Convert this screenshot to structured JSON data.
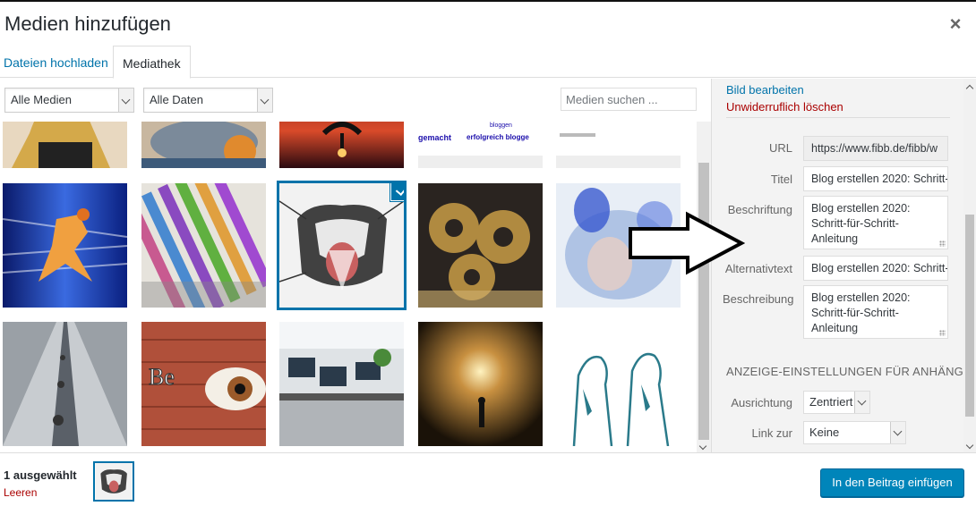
{
  "modal": {
    "title": "Medien hinzufügen",
    "close_icon": "×"
  },
  "tabs": [
    {
      "label": "Dateien hochladen",
      "active": false
    },
    {
      "label": "Mediathek",
      "active": true
    }
  ],
  "filters": {
    "media_type": "Alle Medien",
    "dates": "Alle Daten",
    "search_placeholder": "Medien suchen ..."
  },
  "thumbnails": {
    "partial_text": [
      "gemacht",
      "erfolgreich blogge",
      "bloggen"
    ],
    "selected_index": 2
  },
  "sidebar": {
    "edit_link": "Bild bearbeiten",
    "delete_link": "Unwiderruflich löschen",
    "fields": {
      "url_label": "URL",
      "url_value": "https://www.fibb.de/fibb/w",
      "title_label": "Titel",
      "title_value": "Blog erstellen 2020: Schritt-",
      "caption_label": "Beschriftung",
      "caption_value": "Blog erstellen 2020: Schritt-für-Schritt-Anleitung",
      "alt_label": "Alternativtext",
      "alt_value": "Blog erstellen 2020: Schritt-",
      "description_label": "Beschreibung",
      "description_value": "Blog erstellen 2020: Schritt-für-Schritt-Anleitung"
    },
    "display_heading": "ANZEIGE-EINSTELLUNGEN FÜR ANHÄNGE",
    "align_label": "Ausrichtung",
    "align_value": "Zentriert",
    "link_label": "Link zur",
    "link_value": "Keine"
  },
  "footer": {
    "selection_count": "1 ausgewählt",
    "clear_link": "Leeren",
    "insert_button": "In den Beitrag einfügen"
  },
  "colors": {
    "accent": "#0073aa",
    "button": "#0085ba",
    "danger": "#a00",
    "sidebar_bg": "#f3f3f3"
  }
}
